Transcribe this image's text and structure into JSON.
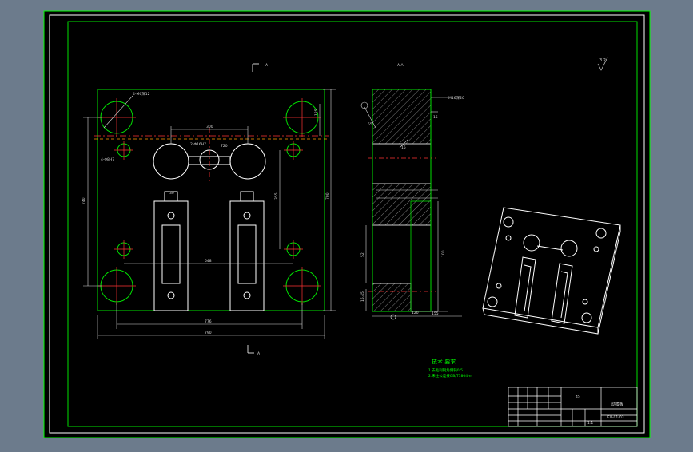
{
  "colors": {
    "background": "#6c7b8c",
    "canvas": "#000000",
    "outline": "#ffffff",
    "frame": "#00e000",
    "dimension": "#d8d8d8",
    "centerline": "#ff3333",
    "hidden": "#ff9900",
    "hatch": "#cfcfcf",
    "notes": "#00ff00"
  },
  "views": {
    "front_section_label": "A",
    "side_section_label": "A-A",
    "bottom_section_label": "A",
    "roughness": "3.2"
  },
  "front_view_dims": {
    "top_hole": "4-M6深12",
    "center_span": "300",
    "center_holes": "2-Φ16H7",
    "width_large": "720",
    "height_label": "700",
    "left_height": "740",
    "lower_span": "548",
    "right_height": "125",
    "pin_hole": "4-Φ8H7",
    "overall_width": "776",
    "overall_width2": "790",
    "small_dim": "30",
    "right_side": "355"
  },
  "side_view_dims": {
    "top_note": "M16深20",
    "dim_left": "55",
    "dim_a": "15",
    "dim_b": "15",
    "dim_mid": "52",
    "dim_right": "100",
    "dim_bottom_a": "15.45",
    "dim_bottom_b": "120",
    "dim_bottom_c": "155"
  },
  "tech_notes": {
    "title": "技术 要求",
    "line1": "1.去毛刺锐角倒钝0.5",
    "line2": "2.未注公差按GB/T1804-m"
  },
  "title_block": {
    "part_name": "动模板",
    "drawing_no": "FU-01-03",
    "material": "45",
    "scale": "1:1"
  }
}
